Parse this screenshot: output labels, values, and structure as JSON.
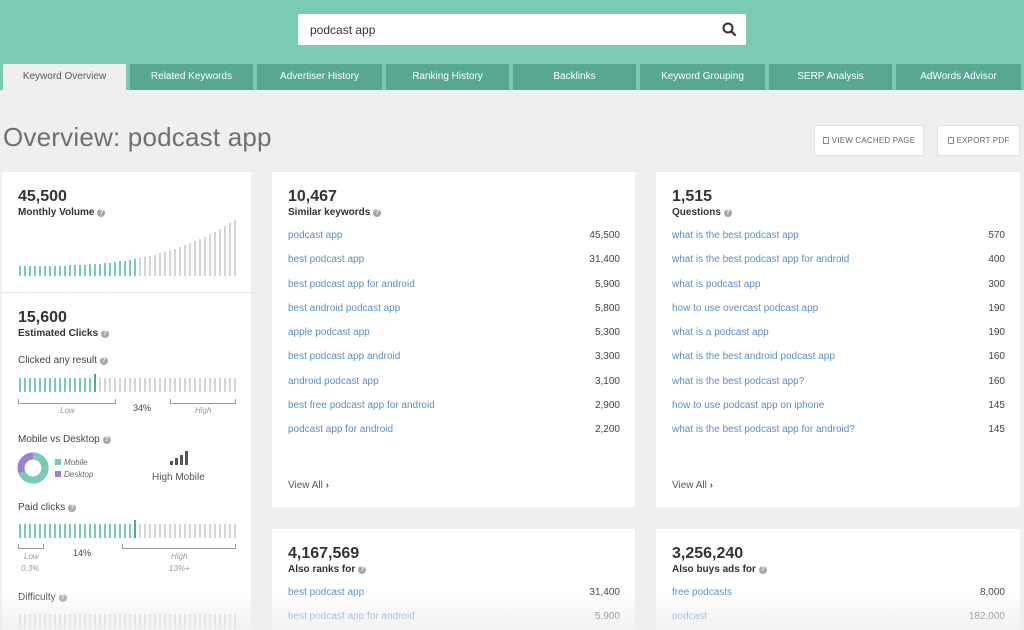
{
  "search": {
    "value": "podcast app"
  },
  "tabs": [
    {
      "label": "Keyword Overview"
    },
    {
      "label": "Related Keywords"
    },
    {
      "label": "Advertiser History"
    },
    {
      "label": "Ranking History"
    },
    {
      "label": "Backlinks"
    },
    {
      "label": "Keyword Grouping"
    },
    {
      "label": "SERP Analysis"
    },
    {
      "label": "AdWords Advisor"
    }
  ],
  "page_title": "Overview: podcast app",
  "toolbar": {
    "view_cached": "VIEW CACHED PAGE",
    "export_pdf": "EXPORT PDF"
  },
  "colors": {
    "accent": "#7acbb3",
    "tab_bg": "#58a891",
    "link": "#5b8ec2",
    "desktop": "#9b7fd4"
  },
  "metrics": {
    "monthly_volume": {
      "value": "45,500",
      "label": "Monthly Volume"
    },
    "estimated_clicks": {
      "value": "15,600",
      "label": "Estimated Clicks"
    },
    "clicked_any_result": {
      "label": "Clicked any result",
      "low": "Low",
      "high": "High",
      "pct": "34%",
      "level": 0.34
    },
    "mobile_vs_desktop": {
      "label": "Mobile vs Desktop",
      "mobile": "Mobile",
      "desktop": "Desktop",
      "result": "High Mobile"
    },
    "paid_clicks": {
      "label": "Paid clicks",
      "low": "Low",
      "low_val": "0.3%",
      "high": "High",
      "high_val": "13%+",
      "pct": "14%"
    },
    "difficulty": {
      "label": "Difficulty"
    }
  },
  "similar": {
    "count": "10,467",
    "label": "Similar keywords",
    "view_all": "View All",
    "rows": [
      {
        "kw": "podcast app",
        "vol": "45,500"
      },
      {
        "kw": "best podcast app",
        "vol": "31,400"
      },
      {
        "kw": "best podcast app for android",
        "vol": "5,900"
      },
      {
        "kw": "best android podcast app",
        "vol": "5,800"
      },
      {
        "kw": "apple podcast app",
        "vol": "5,300"
      },
      {
        "kw": "best podcast app android",
        "vol": "3,300"
      },
      {
        "kw": "android podcast app",
        "vol": "3,100"
      },
      {
        "kw": "best free podcast app for android",
        "vol": "2,900"
      },
      {
        "kw": "podcast app for android",
        "vol": "2,200"
      }
    ]
  },
  "questions": {
    "count": "1,515",
    "label": "Questions",
    "view_all": "View All",
    "rows": [
      {
        "kw": "what is the best podcast app",
        "vol": "570"
      },
      {
        "kw": "what is the best podcast app for android",
        "vol": "400"
      },
      {
        "kw": "what is podcast app",
        "vol": "300"
      },
      {
        "kw": "how to use overcast podcast app",
        "vol": "190"
      },
      {
        "kw": "what is a podcast app",
        "vol": "190"
      },
      {
        "kw": "what is the best android podcast app",
        "vol": "160"
      },
      {
        "kw": "what is the best podcast app?",
        "vol": "160"
      },
      {
        "kw": "how to use podcast app on iphone",
        "vol": "145"
      },
      {
        "kw": "what is the best podcast app for android?",
        "vol": "145"
      }
    ]
  },
  "also_ranks": {
    "count": "4,167,569",
    "label": "Also ranks for",
    "rows": [
      {
        "kw": "best podcast app",
        "vol": "31,400"
      },
      {
        "kw": "best podcast app for android",
        "vol": "5,900"
      }
    ]
  },
  "also_buys": {
    "count": "3,256,240",
    "label": "Also buys ads for",
    "rows": [
      {
        "kw": "free podcasts",
        "vol": "8,000"
      },
      {
        "kw": "podcast",
        "vol": "182,000"
      }
    ]
  }
}
